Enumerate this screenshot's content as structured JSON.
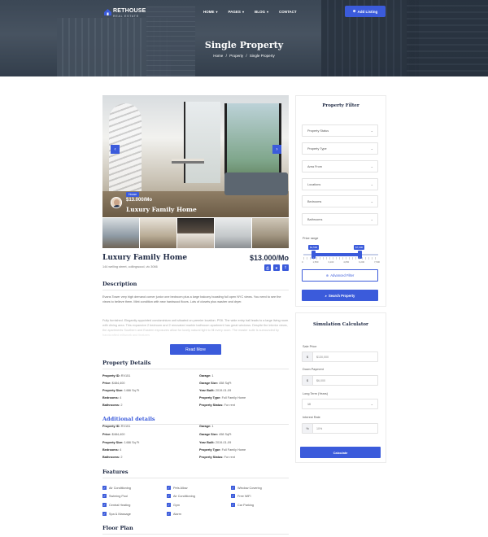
{
  "header": {
    "logo": {
      "name": "RETHOUSE",
      "tagline": "REAL ESTATE"
    },
    "nav": [
      {
        "label": "HOME",
        "dropdown": true
      },
      {
        "label": "PAGES",
        "dropdown": true
      },
      {
        "label": "BLOG",
        "dropdown": true
      },
      {
        "label": "CONTACT",
        "dropdown": false
      }
    ],
    "add_listing": "Add Listing",
    "page_title": "Single Property",
    "breadcrumb": [
      "Home",
      "/",
      "Property",
      "/",
      "Single Property"
    ]
  },
  "gallery": {
    "badge": "House",
    "price": "$13.000/Mo",
    "name": "Luxury Family Home",
    "prev": "‹",
    "next": "›"
  },
  "property": {
    "title": "Luxury Family Home",
    "address": "144 welling street, collingwood, vic 3066",
    "price": "$13.000/Mo"
  },
  "description": {
    "heading": "Description",
    "p1": "Evans Tower very high demand corner junior one bedroom plus a large balcony boasting full open NYC views. You need to see the views to believe them. Mint condition with new hardwood floors. Lots of closets plus washer and dryer.",
    "p2": "Fully furnished. Elegantly appointed condominium unit situated on premier location. PS6. The wide entry hall leads to a large living room with dining area. This expansive 2 bedroom and 2 renovated marble bathroom apartment has great windows. Despite the interior views, the apartments Southern and Eastern exposures allow for lovely natural light to fill every room. The master suite is surrounded by handcrafted milkwork and features",
    "read_more": "Read More"
  },
  "details": {
    "heading": "Property Details",
    "left": [
      {
        "k": "Property ID:",
        "v": "RV151"
      },
      {
        "k": "Price:",
        "v": "$484,400"
      },
      {
        "k": "Property Size:",
        "v": "1466 Sq Ft"
      },
      {
        "k": "Bedrooms:",
        "v": "4"
      },
      {
        "k": "Bathrooms:",
        "v": "2"
      }
    ],
    "right": [
      {
        "k": "Garage:",
        "v": "1"
      },
      {
        "k": "Garage Size:",
        "v": "458 SqFt"
      },
      {
        "k": "Year Built:",
        "v": "2019-01-09"
      },
      {
        "k": "Property Type:",
        "v": "Full Family Home"
      },
      {
        "k": "Property Status:",
        "v": "For rent"
      }
    ]
  },
  "additional": {
    "heading": "Additional details",
    "left": [
      {
        "k": "Property ID:",
        "v": "RV151"
      },
      {
        "k": "Price:",
        "v": "$484,400"
      },
      {
        "k": "Property Size:",
        "v": "1466 Sq Ft"
      },
      {
        "k": "Bedrooms:",
        "v": "4"
      },
      {
        "k": "Bathrooms:",
        "v": "2"
      }
    ],
    "right": [
      {
        "k": "Garage:",
        "v": "1"
      },
      {
        "k": "Garage Size:",
        "v": "458 SqFt"
      },
      {
        "k": "Year Built:",
        "v": "2019-01-09"
      },
      {
        "k": "Property Type:",
        "v": "Full Family Home"
      },
      {
        "k": "Property Status:",
        "v": "For rent"
      }
    ]
  },
  "features": {
    "heading": "Features",
    "items": [
      "Air Conditioning",
      "Pets Allow",
      "Window Covering",
      "Swiming Pool",
      "Air Conditioning",
      "Free WiFi",
      "Central Heating",
      "Gym",
      "Car Parking",
      "Spa & Massage",
      "Alarm"
    ]
  },
  "floor_plan": {
    "heading": "Floor Plan"
  },
  "filter": {
    "heading": "Property Filter",
    "selects": [
      "Property Status",
      "Property Type",
      "Area From",
      "Locations",
      "Bedrooms",
      "Bathrooms"
    ],
    "price_range_label": "Price range",
    "price_min": "$1,500",
    "price_max": "$7,000",
    "ticks": [
      "0",
      "1,550",
      "3,100",
      "4,650",
      "6,200",
      "7,500"
    ],
    "advanced": "Advanced Filter",
    "search": "Search Property"
  },
  "calculator": {
    "heading": "Simulation Calculator",
    "sale_price_label": "Sale Price",
    "sale_price_placeholder": "$130,000",
    "down_payment_label": "Down Payment",
    "down_payment_placeholder": "$6,000",
    "long_term_label": "Long Term (Years)",
    "long_term_value": "10",
    "interest_label": "Interest Rate",
    "interest_placeholder": "10%",
    "currency_symbol": "$",
    "percent_symbol": "%",
    "calculate": "Calculate"
  },
  "colors": {
    "accent": "#3b5bdb",
    "heading": "#1f2a44"
  }
}
